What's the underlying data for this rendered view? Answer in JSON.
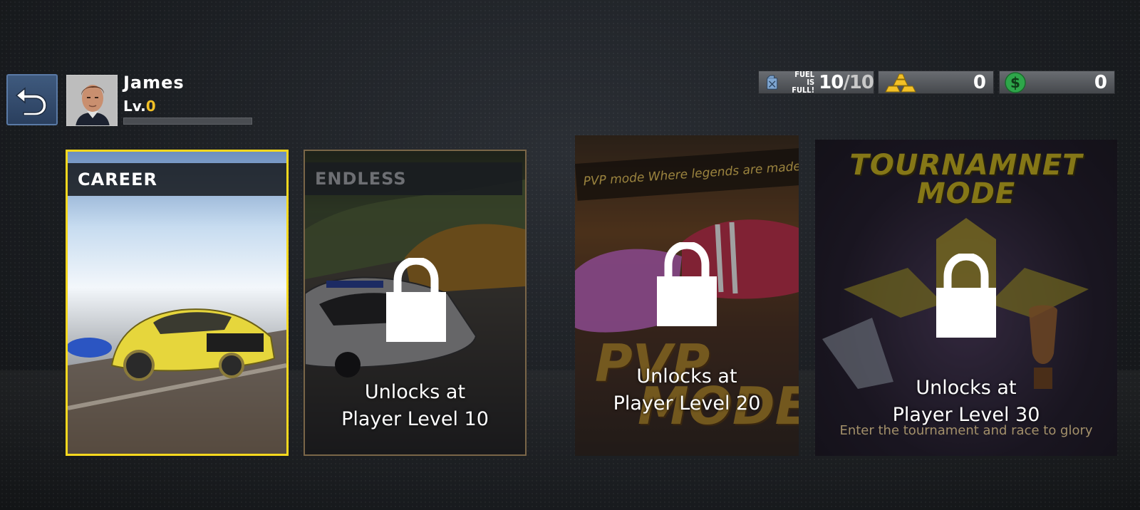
{
  "player": {
    "name": "James",
    "level_prefix": "Lv.",
    "level_value": "0",
    "xp_progress": 0
  },
  "resources": {
    "fuel": {
      "label_line1": "FUEL IS",
      "label_line2": "FULL!",
      "current": "10",
      "max": "/10",
      "icon": "fuel-can-icon"
    },
    "gold": {
      "value": "0",
      "icon": "gold-bars-icon"
    },
    "cash": {
      "value": "0",
      "icon": "dollar-coin-icon"
    }
  },
  "modes": {
    "career": {
      "title": "CAREER",
      "locked": false,
      "selected": true
    },
    "endless": {
      "title": "ENDLESS",
      "locked": true,
      "unlock_line1": "Unlocks at",
      "unlock_line2": "Player Level 10"
    },
    "pvp": {
      "tagline": "PVP mode Where legends are made",
      "logo_line1": "PVP",
      "logo_line2": "MODE",
      "locked": true,
      "unlock_line1": "Unlocks at",
      "unlock_line2": "Player Level 20"
    },
    "tournament": {
      "title_line1": "TOURNAMNET",
      "title_line2": "MODE",
      "tagline": "Enter the tournament and race to glory",
      "locked": true,
      "unlock_line1": "Unlocks at",
      "unlock_line2": "Player Level 30"
    }
  },
  "colors": {
    "accent_yellow": "#f7d81e",
    "level_gold": "#f2c026",
    "back_button": "#3f5a7e",
    "cash_green": "#2ea64a"
  }
}
